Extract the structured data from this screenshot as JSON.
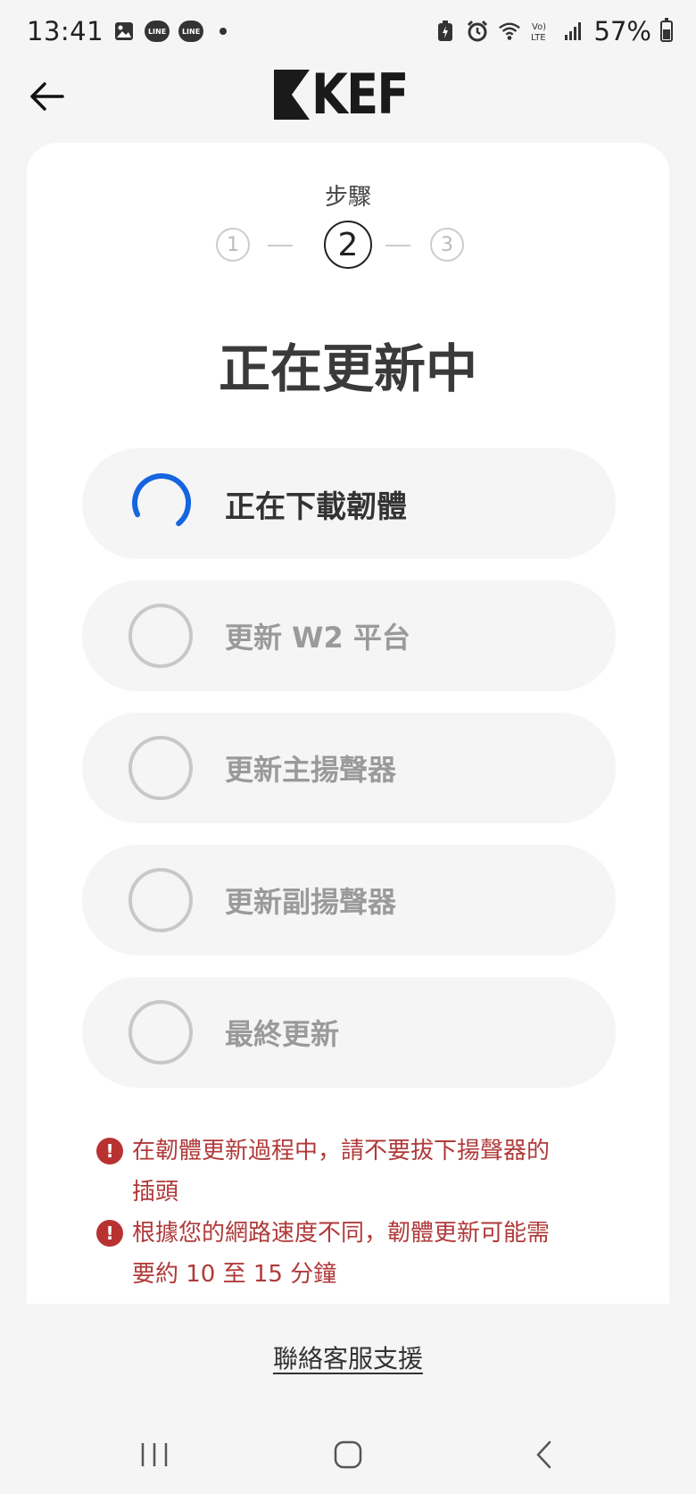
{
  "status_bar": {
    "time": "13:41",
    "line_icon_text": "LINE",
    "battery": "57%"
  },
  "header": {
    "logo_text": "KEF"
  },
  "stepper": {
    "label": "步驟",
    "steps": [
      "1",
      "2",
      "3"
    ],
    "active_step": 2
  },
  "title": "正在更新中",
  "tasks": [
    {
      "label": "正在下載韌體",
      "state": "in-progress"
    },
    {
      "label": "更新 W2 平台",
      "state": "pending"
    },
    {
      "label": "更新主揚聲器",
      "state": "pending"
    },
    {
      "label": "更新副揚聲器",
      "state": "pending"
    },
    {
      "label": "最終更新",
      "state": "pending"
    }
  ],
  "warnings": [
    {
      "line1": "在韌體更新過程中，請不要拔下揚聲器的",
      "line2": "插頭"
    },
    {
      "line1": "根據您的網路速度不同，韌體更新可能需",
      "line2": "要約 10 至 15 分鐘"
    }
  ],
  "support_link": "聯絡客服支援",
  "colors": {
    "spinner": "#1565e0",
    "warning": "#b83232",
    "background": "#f5f5f5",
    "card": "#ffffff"
  }
}
